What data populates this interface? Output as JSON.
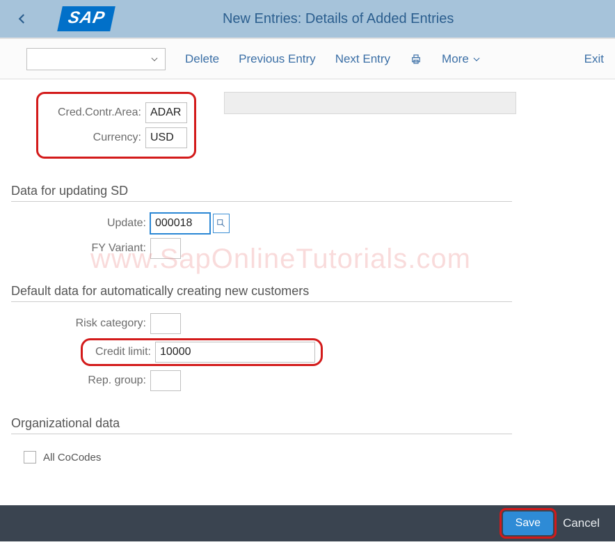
{
  "header": {
    "title": "New Entries: Details of Added Entries",
    "logo_text": "SAP"
  },
  "toolbar": {
    "delete": "Delete",
    "prev": "Previous Entry",
    "next": "Next Entry",
    "more": "More",
    "exit": "Exit"
  },
  "top": {
    "cred_area_label": "Cred.Contr.Area:",
    "cred_area_value": "ADAR",
    "currency_label": "Currency:",
    "currency_value": "USD"
  },
  "section_sd": {
    "title": "Data for updating SD",
    "update_label": "Update:",
    "update_value": "000018",
    "fy_label": "FY Variant:",
    "fy_value": ""
  },
  "section_default": {
    "title": "Default data for automatically creating new customers",
    "risk_label": "Risk category:",
    "risk_value": "",
    "credit_label": "Credit limit:",
    "credit_value": "10000",
    "rep_label": "Rep. group:",
    "rep_value": ""
  },
  "section_org": {
    "title": "Organizational data",
    "all_cocodes_label": "All CoCodes"
  },
  "footer": {
    "save": "Save",
    "cancel": "Cancel"
  },
  "watermark": "www.SapOnlineTutorials.com"
}
